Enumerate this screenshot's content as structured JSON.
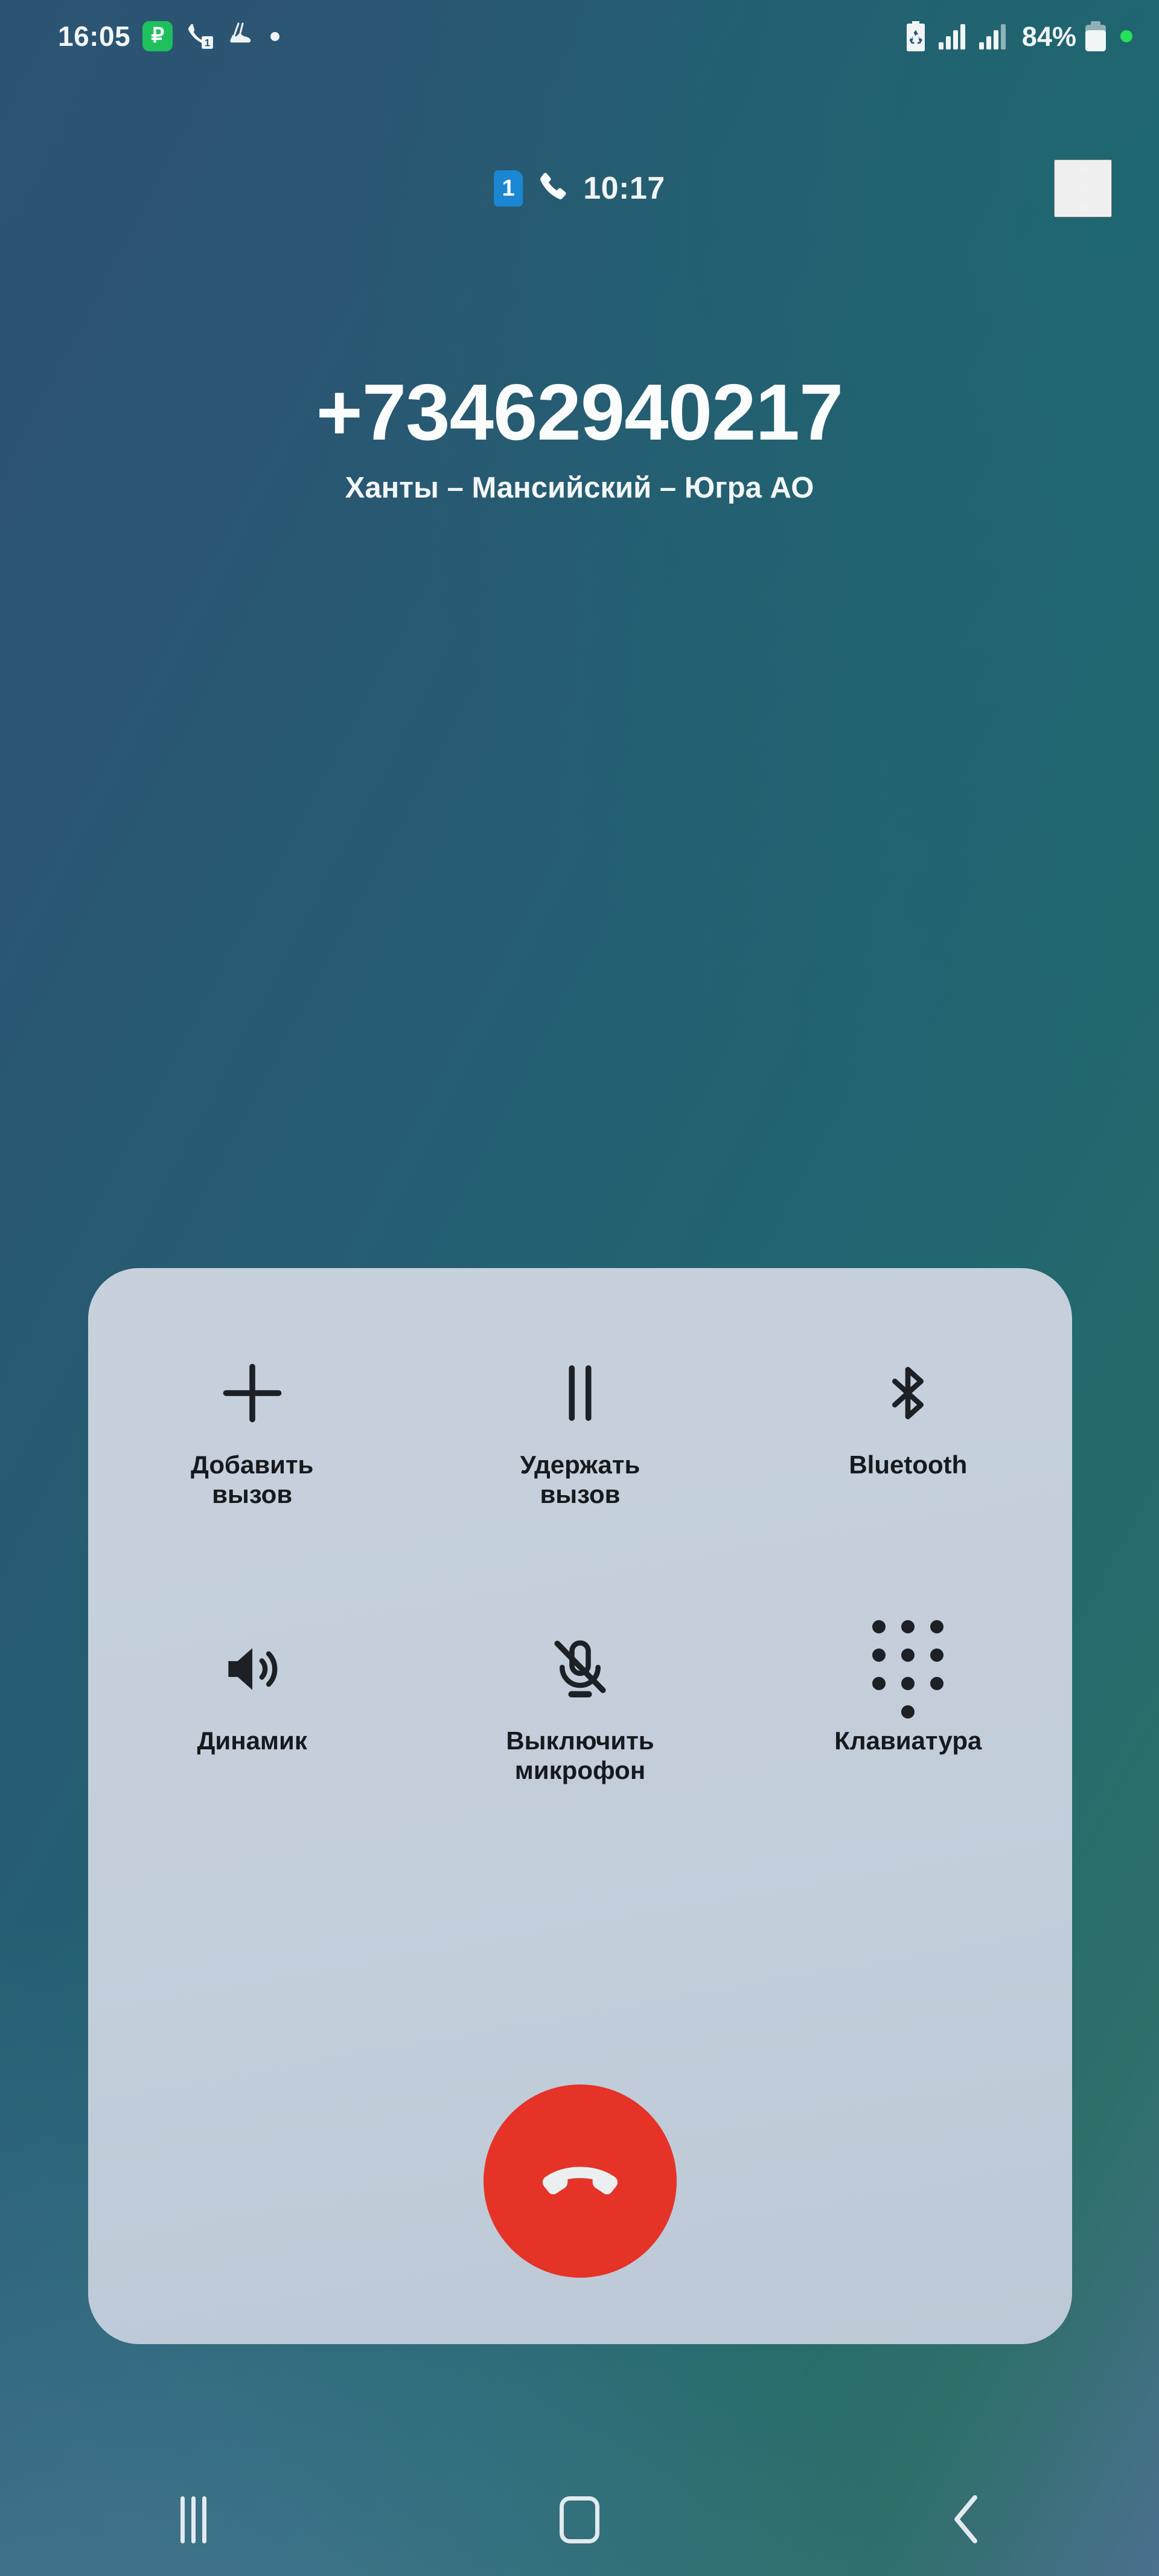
{
  "status_bar": {
    "clock": "16:05",
    "pay_badge_label": "₽",
    "icons": [
      "pay-icon",
      "missed-call-1-icon",
      "sneaker-icon",
      "dot-icon"
    ],
    "missed_call_count": "1",
    "battery_percent": "84%",
    "right_icons": [
      "battery-saver-icon",
      "sim1-signal-icon",
      "sim2-signal-icon",
      "battery-icon",
      "green-status-dot-icon"
    ],
    "sim1_signal_bars": 4,
    "sim2_signal_bars": 3
  },
  "call_header": {
    "sim_badge": "1",
    "phone_icon": "phone-handset-icon",
    "duration": "10:17",
    "overflow_icon": "overflow-menu-icon"
  },
  "caller": {
    "number": "+73462940217",
    "location": "Ханты – Мансийский – Югра АО"
  },
  "controls": {
    "buttons": [
      {
        "label": "Добавить вызов",
        "icon": "plus-icon",
        "name": "add-call-button"
      },
      {
        "label": "Удержать вызов",
        "icon": "pause-icon",
        "name": "hold-call-button"
      },
      {
        "label": "Bluetooth",
        "icon": "bluetooth-icon",
        "name": "bluetooth-button"
      },
      {
        "label": "Динамик",
        "icon": "speaker-icon",
        "name": "speaker-button"
      },
      {
        "label": "Выключить микрофон",
        "icon": "mic-off-icon",
        "name": "mute-button"
      },
      {
        "label": "Клавиатура",
        "icon": "keypad-icon",
        "name": "keypad-button"
      }
    ],
    "end_call": {
      "icon": "end-call-icon",
      "color": "#e53328"
    }
  },
  "nav_bar": {
    "recents": "recents-icon",
    "home": "home-icon",
    "back": "back-icon"
  },
  "colors": {
    "background_left": "#2c5373",
    "background_right": "#1e676e",
    "card": "#c3cedb",
    "end_call_red": "#e53328",
    "sim_badge_blue": "#1b87d2",
    "pay_green": "#1ec05e"
  }
}
